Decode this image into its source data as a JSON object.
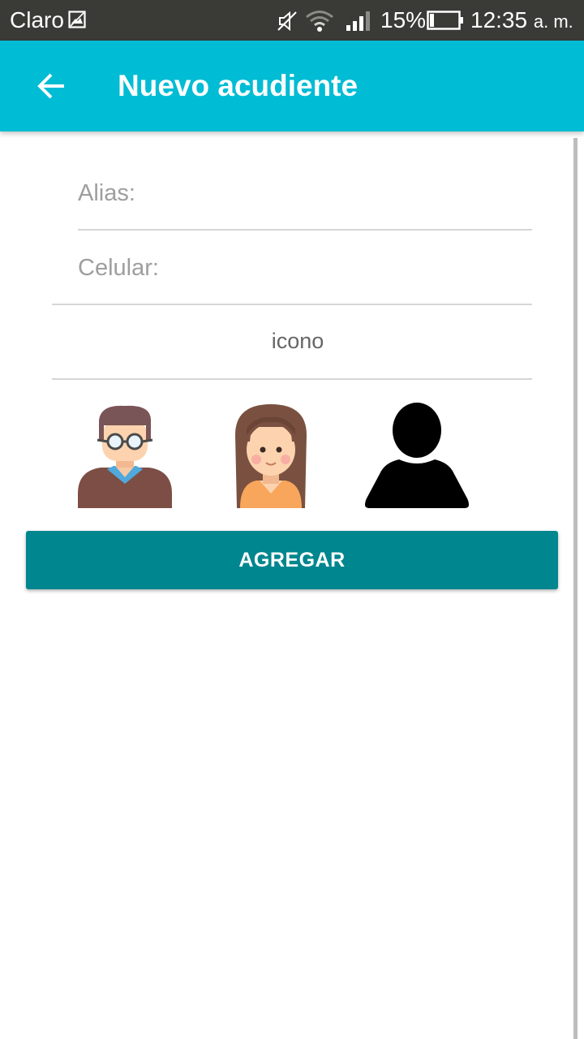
{
  "status_bar": {
    "carrier": "Claro",
    "battery_percent": "15%",
    "time": "12:35",
    "ampm": "a. m."
  },
  "app_bar": {
    "back_icon": "arrow-back-icon",
    "title": "Nuevo acudiente"
  },
  "form": {
    "alias": {
      "placeholder": "Alias:",
      "value": ""
    },
    "celular": {
      "placeholder": "Celular:",
      "value": ""
    },
    "icon_label": "icono",
    "avatars": [
      "man-with-glasses-avatar",
      "woman-avatar",
      "generic-person-avatar"
    ]
  },
  "actions": {
    "add_label": "AGREGAR"
  },
  "colors": {
    "status_bar": "#3a3a36",
    "app_bar": "#00bcd4",
    "button": "#00868f",
    "divider": "#d6d6d6",
    "placeholder": "#9e9e9e"
  }
}
